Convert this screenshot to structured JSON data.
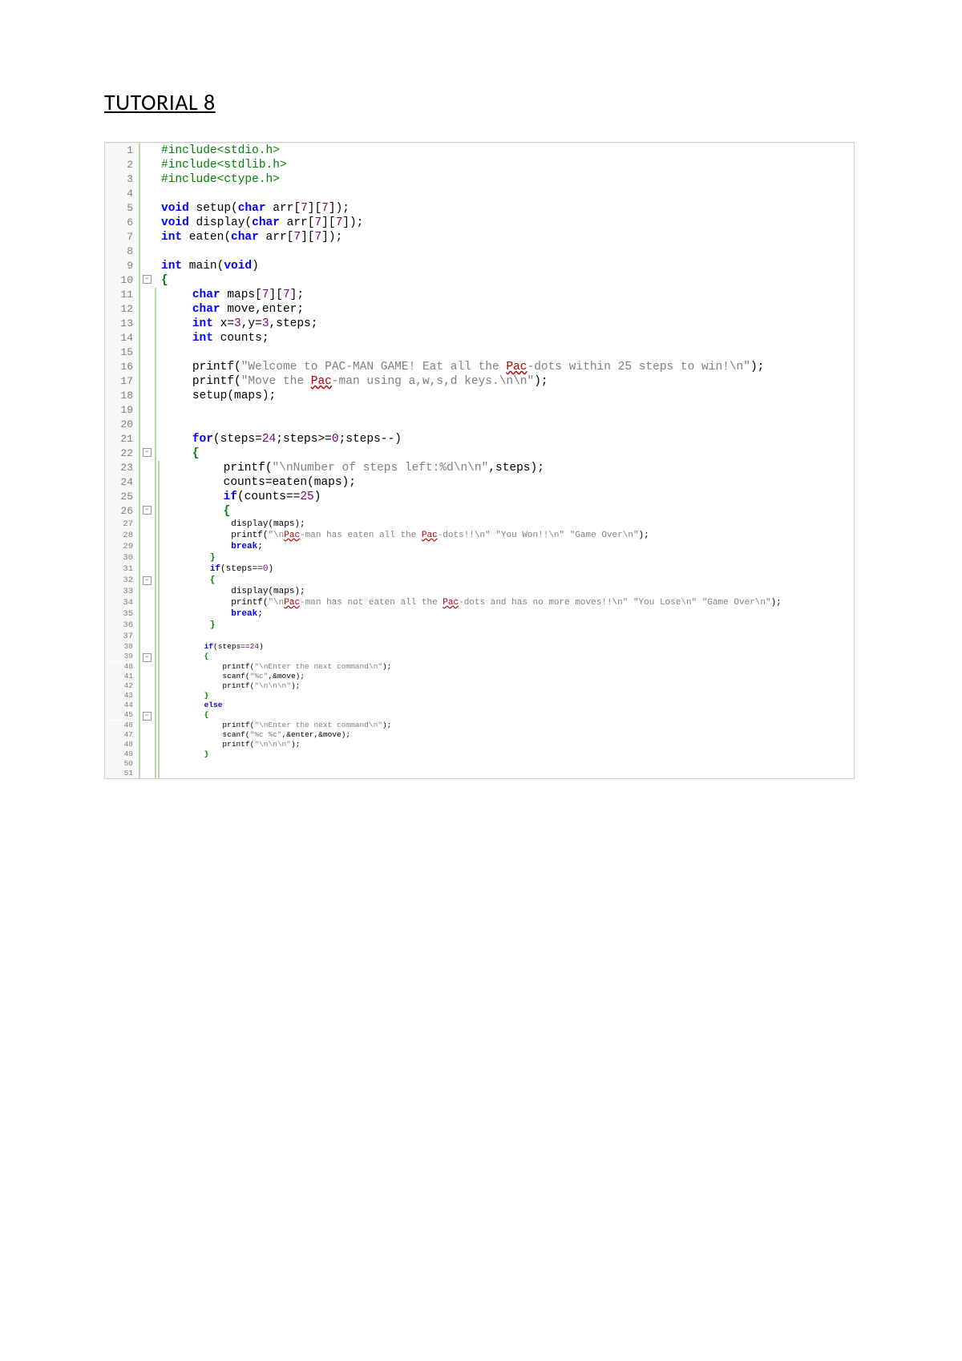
{
  "title": "TUTORIAL 8",
  "lines": [
    {
      "n": 1,
      "size": "a",
      "fold": "",
      "bars": 1,
      "indent": 0,
      "tokens": [
        {
          "c": "pp",
          "t": "#include<stdio.h>"
        }
      ]
    },
    {
      "n": 2,
      "size": "a",
      "fold": "",
      "bars": 1,
      "indent": 0,
      "tokens": [
        {
          "c": "pp",
          "t": "#include<stdlib.h>"
        }
      ]
    },
    {
      "n": 3,
      "size": "a",
      "fold": "",
      "bars": 1,
      "indent": 0,
      "tokens": [
        {
          "c": "pp",
          "t": "#include<ctype.h>"
        }
      ]
    },
    {
      "n": 4,
      "size": "a",
      "fold": "",
      "bars": 1,
      "indent": 0,
      "tokens": []
    },
    {
      "n": 5,
      "size": "a",
      "fold": "",
      "bars": 1,
      "indent": 0,
      "tokens": [
        {
          "c": "kw",
          "t": "void"
        },
        {
          "c": "plain",
          "t": " setup("
        },
        {
          "c": "kw",
          "t": "char"
        },
        {
          "c": "plain",
          "t": " arr["
        },
        {
          "c": "num",
          "t": "7"
        },
        {
          "c": "plain",
          "t": "]["
        },
        {
          "c": "num",
          "t": "7"
        },
        {
          "c": "plain",
          "t": "]);"
        }
      ]
    },
    {
      "n": 6,
      "size": "a",
      "fold": "",
      "bars": 1,
      "indent": 0,
      "tokens": [
        {
          "c": "kw",
          "t": "void"
        },
        {
          "c": "plain",
          "t": " display("
        },
        {
          "c": "kw",
          "t": "char"
        },
        {
          "c": "plain",
          "t": " arr["
        },
        {
          "c": "num",
          "t": "7"
        },
        {
          "c": "plain",
          "t": "]["
        },
        {
          "c": "num",
          "t": "7"
        },
        {
          "c": "plain",
          "t": "]);"
        }
      ]
    },
    {
      "n": 7,
      "size": "a",
      "fold": "",
      "bars": 1,
      "indent": 0,
      "tokens": [
        {
          "c": "kw",
          "t": "int"
        },
        {
          "c": "plain",
          "t": " eaten("
        },
        {
          "c": "kw",
          "t": "char"
        },
        {
          "c": "plain",
          "t": " arr["
        },
        {
          "c": "num",
          "t": "7"
        },
        {
          "c": "plain",
          "t": "]["
        },
        {
          "c": "num",
          "t": "7"
        },
        {
          "c": "plain",
          "t": "]);"
        }
      ]
    },
    {
      "n": 8,
      "size": "a",
      "fold": "",
      "bars": 1,
      "indent": 0,
      "tokens": []
    },
    {
      "n": 9,
      "size": "a",
      "fold": "",
      "bars": 1,
      "indent": 0,
      "tokens": [
        {
          "c": "kw",
          "t": "int"
        },
        {
          "c": "plain",
          "t": " main("
        },
        {
          "c": "kw",
          "t": "void"
        },
        {
          "c": "plain",
          "t": ")"
        }
      ]
    },
    {
      "n": 10,
      "size": "a",
      "fold": "minus",
      "bars": 1,
      "indent": 0,
      "tokens": [
        {
          "c": "br",
          "t": "{"
        }
      ]
    },
    {
      "n": 11,
      "size": "a",
      "fold": "",
      "bars": 2,
      "indent": 1,
      "tokens": [
        {
          "c": "kw",
          "t": "char"
        },
        {
          "c": "plain",
          "t": " maps["
        },
        {
          "c": "num",
          "t": "7"
        },
        {
          "c": "plain",
          "t": "]["
        },
        {
          "c": "num",
          "t": "7"
        },
        {
          "c": "plain",
          "t": "];"
        }
      ]
    },
    {
      "n": 12,
      "size": "a",
      "fold": "",
      "bars": 2,
      "indent": 1,
      "tokens": [
        {
          "c": "kw",
          "t": "char"
        },
        {
          "c": "plain",
          "t": " move,enter;"
        }
      ]
    },
    {
      "n": 13,
      "size": "a",
      "fold": "",
      "bars": 2,
      "indent": 1,
      "tokens": [
        {
          "c": "kw",
          "t": "int"
        },
        {
          "c": "plain",
          "t": " x="
        },
        {
          "c": "num",
          "t": "3"
        },
        {
          "c": "plain",
          "t": ",y="
        },
        {
          "c": "num",
          "t": "3"
        },
        {
          "c": "plain",
          "t": ",steps;"
        }
      ]
    },
    {
      "n": 14,
      "size": "a",
      "fold": "",
      "bars": 2,
      "indent": 1,
      "tokens": [
        {
          "c": "kw",
          "t": "int"
        },
        {
          "c": "plain",
          "t": " counts;"
        }
      ]
    },
    {
      "n": 15,
      "size": "a",
      "fold": "",
      "bars": 2,
      "indent": 1,
      "tokens": []
    },
    {
      "n": 16,
      "size": "a",
      "fold": "",
      "bars": 2,
      "indent": 1,
      "tokens": [
        {
          "c": "plain",
          "t": "printf("
        },
        {
          "c": "str",
          "t": "\"Welcome to PAC-MAN GAME! Eat all the "
        },
        {
          "c": "err",
          "t": "Pac"
        },
        {
          "c": "str",
          "t": "-dots within 25 steps to win!\\n\""
        },
        {
          "c": "plain",
          "t": ");"
        }
      ]
    },
    {
      "n": 17,
      "size": "a",
      "fold": "",
      "bars": 2,
      "indent": 1,
      "tokens": [
        {
          "c": "plain",
          "t": "printf("
        },
        {
          "c": "str",
          "t": "\"Move the "
        },
        {
          "c": "err",
          "t": "Pac"
        },
        {
          "c": "str",
          "t": "-man using a,w,s,d keys.\\n\\n\""
        },
        {
          "c": "plain",
          "t": ");"
        }
      ]
    },
    {
      "n": 18,
      "size": "a",
      "fold": "",
      "bars": 2,
      "indent": 1,
      "tokens": [
        {
          "c": "plain",
          "t": "setup(maps);"
        }
      ]
    },
    {
      "n": 19,
      "size": "a",
      "fold": "",
      "bars": 2,
      "indent": 1,
      "tokens": []
    },
    {
      "n": 20,
      "size": "a",
      "fold": "",
      "bars": 2,
      "indent": 1,
      "tokens": []
    },
    {
      "n": 21,
      "size": "a",
      "fold": "",
      "bars": 2,
      "indent": 1,
      "tokens": [
        {
          "c": "kw",
          "t": "for"
        },
        {
          "c": "plain",
          "t": "(steps="
        },
        {
          "c": "num",
          "t": "24"
        },
        {
          "c": "plain",
          "t": ";steps>="
        },
        {
          "c": "num",
          "t": "0"
        },
        {
          "c": "plain",
          "t": ";steps--)"
        }
      ]
    },
    {
      "n": 22,
      "size": "a",
      "fold": "minus",
      "bars": 2,
      "indent": 1,
      "tokens": [
        {
          "c": "br",
          "t": "{"
        }
      ]
    },
    {
      "n": 23,
      "size": "a",
      "fold": "",
      "bars": 3,
      "indent": 2,
      "tokens": [
        {
          "c": "plain",
          "t": "printf("
        },
        {
          "c": "str",
          "t": "\"\\nNumber of steps left:%d\\n\\n\""
        },
        {
          "c": "plain",
          "t": ",steps);"
        }
      ]
    },
    {
      "n": 24,
      "size": "a",
      "fold": "",
      "bars": 3,
      "indent": 2,
      "tokens": [
        {
          "c": "plain",
          "t": "counts=eaten(maps);"
        }
      ]
    },
    {
      "n": 25,
      "size": "a",
      "fold": "",
      "bars": 3,
      "indent": 2,
      "tokens": [
        {
          "c": "kw",
          "t": "if"
        },
        {
          "c": "plain",
          "t": "(counts=="
        },
        {
          "c": "num",
          "t": "25"
        },
        {
          "c": "plain",
          "t": ")"
        }
      ]
    },
    {
      "n": 26,
      "size": "a",
      "fold": "minus",
      "bars": 3,
      "indent": 2,
      "tokens": [
        {
          "c": "br",
          "t": "{"
        }
      ]
    },
    {
      "n": 27,
      "size": "b",
      "fold": "",
      "bars": 3,
      "indent": 3,
      "tokens": [
        {
          "c": "plain",
          "t": "display(maps);"
        }
      ]
    },
    {
      "n": 28,
      "size": "b",
      "fold": "",
      "bars": 3,
      "indent": 3,
      "tokens": [
        {
          "c": "plain",
          "t": "printf("
        },
        {
          "c": "str",
          "t": "\"\\n"
        },
        {
          "c": "err",
          "t": "Pac"
        },
        {
          "c": "str",
          "t": "-man has eaten all the "
        },
        {
          "c": "err",
          "t": "Pac"
        },
        {
          "c": "str",
          "t": "-dots!!\\n\" \"You Won!!\\n\" \"Game Over\\n\""
        },
        {
          "c": "plain",
          "t": ");"
        }
      ]
    },
    {
      "n": 29,
      "size": "b",
      "fold": "",
      "bars": 3,
      "indent": 3,
      "tokens": [
        {
          "c": "kw",
          "t": "break"
        },
        {
          "c": "plain",
          "t": ";"
        }
      ]
    },
    {
      "n": 30,
      "size": "b",
      "fold": "",
      "bars": 3,
      "indent": 2,
      "tokens": [
        {
          "c": "br",
          "t": "}"
        }
      ]
    },
    {
      "n": 31,
      "size": "b",
      "fold": "",
      "bars": 3,
      "indent": 2,
      "tokens": [
        {
          "c": "kw",
          "t": "if"
        },
        {
          "c": "plain",
          "t": "(steps=="
        },
        {
          "c": "num",
          "t": "0"
        },
        {
          "c": "plain",
          "t": ")"
        }
      ]
    },
    {
      "n": 32,
      "size": "b",
      "fold": "minus",
      "bars": 3,
      "indent": 2,
      "tokens": [
        {
          "c": "br",
          "t": "{"
        }
      ]
    },
    {
      "n": 33,
      "size": "b",
      "fold": "",
      "bars": 3,
      "indent": 3,
      "tokens": [
        {
          "c": "plain",
          "t": "display(maps);"
        }
      ]
    },
    {
      "n": 34,
      "size": "b",
      "fold": "",
      "bars": 3,
      "indent": 3,
      "tokens": [
        {
          "c": "plain",
          "t": "printf("
        },
        {
          "c": "str",
          "t": "\"\\n"
        },
        {
          "c": "err",
          "t": "Pac"
        },
        {
          "c": "str",
          "t": "-man has not eaten all the "
        },
        {
          "c": "err",
          "t": "Pac"
        },
        {
          "c": "str",
          "t": "-dots and has no more moves!!\\n\" \"You Lose\\n\" \"Game Over\\n\""
        },
        {
          "c": "plain",
          "t": ");"
        }
      ]
    },
    {
      "n": 35,
      "size": "b",
      "fold": "",
      "bars": 3,
      "indent": 3,
      "tokens": [
        {
          "c": "kw",
          "t": "break"
        },
        {
          "c": "plain",
          "t": ";"
        }
      ]
    },
    {
      "n": 36,
      "size": "b",
      "fold": "",
      "bars": 3,
      "indent": 2,
      "tokens": [
        {
          "c": "br",
          "t": "}"
        }
      ]
    },
    {
      "n": 37,
      "size": "b",
      "fold": "",
      "bars": 3,
      "indent": 2,
      "tokens": []
    },
    {
      "n": 38,
      "size": "c",
      "fold": "",
      "bars": 3,
      "indent": 2,
      "tokens": [
        {
          "c": "kw",
          "t": "if"
        },
        {
          "c": "plain",
          "t": "(steps=="
        },
        {
          "c": "num",
          "t": "24"
        },
        {
          "c": "plain",
          "t": ")"
        }
      ]
    },
    {
      "n": 39,
      "size": "c",
      "fold": "minus",
      "bars": 3,
      "indent": 2,
      "tokens": [
        {
          "c": "br",
          "t": "{"
        }
      ]
    },
    {
      "n": 40,
      "size": "c",
      "fold": "",
      "bars": 3,
      "indent": 3,
      "tokens": [
        {
          "c": "plain",
          "t": "printf("
        },
        {
          "c": "str",
          "t": "\"\\nEnter the next command\\n\""
        },
        {
          "c": "plain",
          "t": ");"
        }
      ]
    },
    {
      "n": 41,
      "size": "c",
      "fold": "",
      "bars": 3,
      "indent": 3,
      "tokens": [
        {
          "c": "plain",
          "t": "scanf("
        },
        {
          "c": "str",
          "t": "\"%c\""
        },
        {
          "c": "plain",
          "t": ",&move);"
        }
      ]
    },
    {
      "n": 42,
      "size": "c",
      "fold": "",
      "bars": 3,
      "indent": 3,
      "tokens": [
        {
          "c": "plain",
          "t": "printf("
        },
        {
          "c": "str",
          "t": "\"\\n\\n\\n\""
        },
        {
          "c": "plain",
          "t": ");"
        }
      ]
    },
    {
      "n": 43,
      "size": "c",
      "fold": "",
      "bars": 3,
      "indent": 2,
      "tokens": [
        {
          "c": "br",
          "t": "}"
        }
      ]
    },
    {
      "n": 44,
      "size": "c",
      "fold": "",
      "bars": 3,
      "indent": 2,
      "tokens": [
        {
          "c": "kw",
          "t": "else"
        }
      ]
    },
    {
      "n": 45,
      "size": "c",
      "fold": "minus",
      "bars": 3,
      "indent": 2,
      "tokens": [
        {
          "c": "br",
          "t": "{"
        }
      ]
    },
    {
      "n": 46,
      "size": "c",
      "fold": "",
      "bars": 3,
      "indent": 3,
      "tokens": [
        {
          "c": "plain",
          "t": "printf("
        },
        {
          "c": "str",
          "t": "\"\\nEnter the next command\\n\""
        },
        {
          "c": "plain",
          "t": ");"
        }
      ]
    },
    {
      "n": 47,
      "size": "c",
      "fold": "",
      "bars": 3,
      "indent": 3,
      "tokens": [
        {
          "c": "plain",
          "t": "scanf("
        },
        {
          "c": "str",
          "t": "\"%c %c\""
        },
        {
          "c": "plain",
          "t": ",&enter,&move);"
        }
      ]
    },
    {
      "n": 48,
      "size": "c",
      "fold": "",
      "bars": 3,
      "indent": 3,
      "tokens": [
        {
          "c": "plain",
          "t": "printf("
        },
        {
          "c": "str",
          "t": "\"\\n\\n\\n\""
        },
        {
          "c": "plain",
          "t": ");"
        }
      ]
    },
    {
      "n": 49,
      "size": "c",
      "fold": "",
      "bars": 3,
      "indent": 2,
      "tokens": [
        {
          "c": "br",
          "t": "}"
        }
      ]
    },
    {
      "n": 50,
      "size": "c",
      "fold": "",
      "bars": 3,
      "indent": 2,
      "tokens": []
    },
    {
      "n": 51,
      "size": "c",
      "fold": "",
      "bars": 3,
      "indent": 2,
      "tokens": []
    }
  ]
}
